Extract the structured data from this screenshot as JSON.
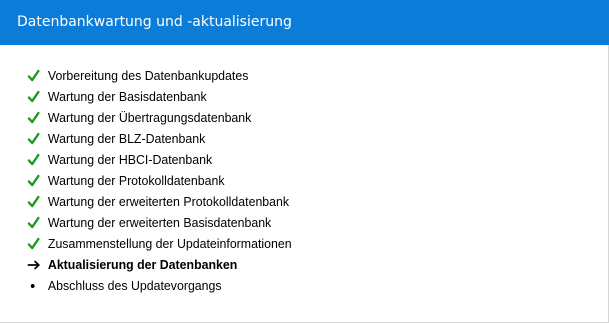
{
  "dialog": {
    "title": "Datenbankwartung und -aktualisierung",
    "accent_color": "#0b7dd8"
  },
  "steps": [
    {
      "label": "Vorbereitung des Datenbankupdates",
      "status": "done",
      "icon": "check-icon"
    },
    {
      "label": "Wartung der Basisdatenbank",
      "status": "done",
      "icon": "check-icon"
    },
    {
      "label": "Wartung der Übertragungsdatenbank",
      "status": "done",
      "icon": "check-icon"
    },
    {
      "label": "Wartung der BLZ-Datenbank",
      "status": "done",
      "icon": "check-icon"
    },
    {
      "label": "Wartung der HBCI-Datenbank",
      "status": "done",
      "icon": "check-icon"
    },
    {
      "label": "Wartung der Protokolldatenbank",
      "status": "done",
      "icon": "check-icon"
    },
    {
      "label": "Wartung der erweiterten Protokolldatenbank",
      "status": "done",
      "icon": "check-icon"
    },
    {
      "label": "Wartung der erweiterten Basisdatenbank",
      "status": "done",
      "icon": "check-icon"
    },
    {
      "label": "Zusammenstellung der Updateinformationen",
      "status": "done",
      "icon": "check-icon"
    },
    {
      "label": "Aktualisierung der Datenbanken",
      "status": "current",
      "icon": "arrow-right-icon"
    },
    {
      "label": "Abschluss des Updatevorgangs",
      "status": "pending",
      "icon": "bullet-icon"
    }
  ]
}
